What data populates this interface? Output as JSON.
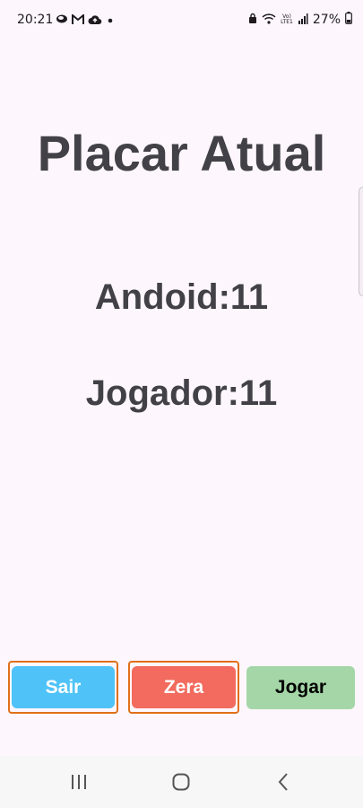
{
  "status_bar": {
    "time": "20:21",
    "left_icons": [
      "smartphone-sync-icon",
      "gmail-icon",
      "cloud-upload-icon",
      "dot-icon"
    ],
    "right_icons": [
      "lock-icon",
      "wifi-icon",
      "volte-icon",
      "signal-icon",
      "battery-icon"
    ],
    "volte_top": "Vo)",
    "volte_bottom": "LTE1",
    "battery": "27%"
  },
  "main": {
    "title": "Placar Atual",
    "android_score": "Andoid:11",
    "player_score": "Jogador:11"
  },
  "buttons": {
    "sair": "Sair",
    "zera": "Zera",
    "jogar": "Jogar"
  },
  "colors": {
    "background": "#fdf6fd",
    "text": "#424147",
    "sair": "#4fc3f7",
    "zera": "#f26b5e",
    "jogar": "#a5d6a7",
    "focus_border": "#e0701a"
  },
  "nav_bar": {
    "icons": [
      "recents-icon",
      "home-icon",
      "back-icon"
    ]
  }
}
